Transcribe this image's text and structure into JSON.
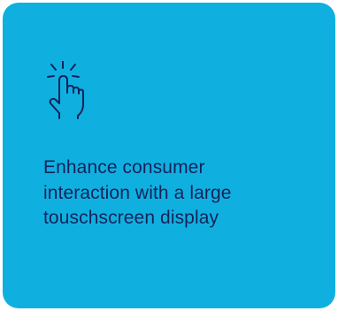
{
  "card": {
    "background_color": "#0fb0e0",
    "text_color": "#14235a",
    "icon": "touch-tap-icon",
    "lines": [
      "Enhance consumer",
      "interaction with a large",
      "touschscreen display"
    ]
  }
}
